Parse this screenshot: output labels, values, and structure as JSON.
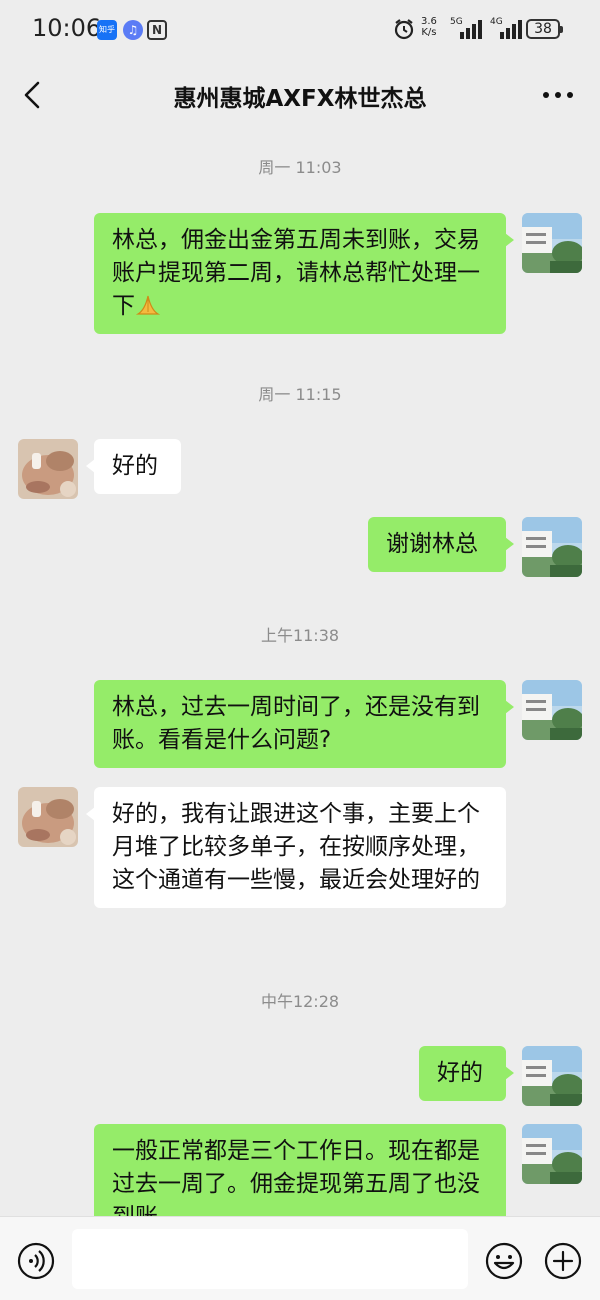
{
  "status_bar": {
    "time": "10:06",
    "app_icons": [
      "zhihu-icon",
      "music-icon",
      "nfc-icon"
    ],
    "zhihu_label": "知乎",
    "nfc_label": "N",
    "music_label": "♫",
    "net_speed_value": "3.6",
    "net_speed_unit": "K/s",
    "network_5g": "5G",
    "network_4g": "4G",
    "battery": "38"
  },
  "title_bar": {
    "title": "惠州惠城AXFX林世杰总"
  },
  "messages": [
    {
      "type": "timestamp",
      "text": "周一 11:03"
    },
    {
      "type": "sent",
      "text": "林总，佣金出金第五周未到账，交易账户提现第二周，请林总帮忙处理一下",
      "emoji": "folded-hands-icon"
    },
    {
      "type": "timestamp",
      "text": "周一 11:15"
    },
    {
      "type": "received",
      "text": "好的"
    },
    {
      "type": "sent",
      "text": "谢谢林总"
    },
    {
      "type": "timestamp",
      "text": "上午11:38"
    },
    {
      "type": "sent",
      "text": "林总，过去一周时间了，还是没有到账。看看是什么问题?"
    },
    {
      "type": "received",
      "text": "好的，我有让跟进这个事，主要上个月堆了比较多单子，在按顺序处理，这个通道有一些慢，最近会处理好的"
    },
    {
      "type": "timestamp",
      "text": "中午12:28"
    },
    {
      "type": "sent",
      "text": "好的"
    },
    {
      "type": "sent",
      "text": "一般正常都是三个工作日。现在都是过去一周了。佣金提现第五周了也没到账"
    }
  ],
  "input_bar": {
    "placeholder": ""
  },
  "colors": {
    "background": "#ededed",
    "sent_bubble": "#95ec69",
    "received_bubble": "#ffffff",
    "timestamp": "#8c8c8c"
  }
}
